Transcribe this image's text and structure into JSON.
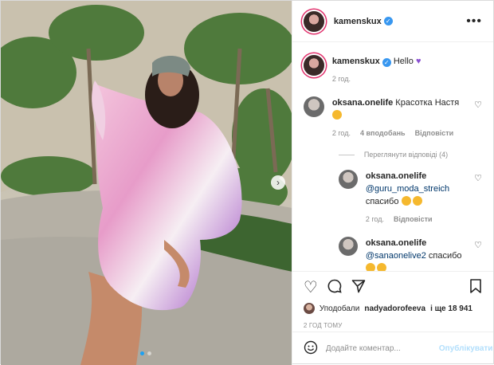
{
  "header": {
    "username": "kamenskux",
    "more_icon": "more-horizontal-icon"
  },
  "caption": {
    "username": "kamenskux",
    "text": "Hello",
    "emoji": "purple-heart",
    "time": "2 год."
  },
  "comments": [
    {
      "username": "oksana.onelife",
      "text": "Красотка Настя",
      "emoji": "heart-eyes",
      "time": "2 год.",
      "likes": "4 вподобань",
      "reply_label": "Відповісти"
    }
  ],
  "view_replies": "Переглянути відповіді (4)",
  "replies": [
    {
      "username": "oksana.onelife",
      "mention": "@guru_moda_streich",
      "text": "спасибо",
      "time": "2 год.",
      "reply_label": "Відповісти"
    },
    {
      "username": "oksana.onelife",
      "mention": "@sanaonelive2",
      "text": "спасибо"
    }
  ],
  "likes": {
    "prefix": "Уподобали",
    "user": "nadyadorofeeva",
    "suffix": "і ще 18 941"
  },
  "post_time": "2 ГОД ТОМУ",
  "add_comment": {
    "placeholder": "Додайте коментар...",
    "post_label": "Опублікувати"
  },
  "carousel": {
    "current": 1,
    "total": 2
  }
}
